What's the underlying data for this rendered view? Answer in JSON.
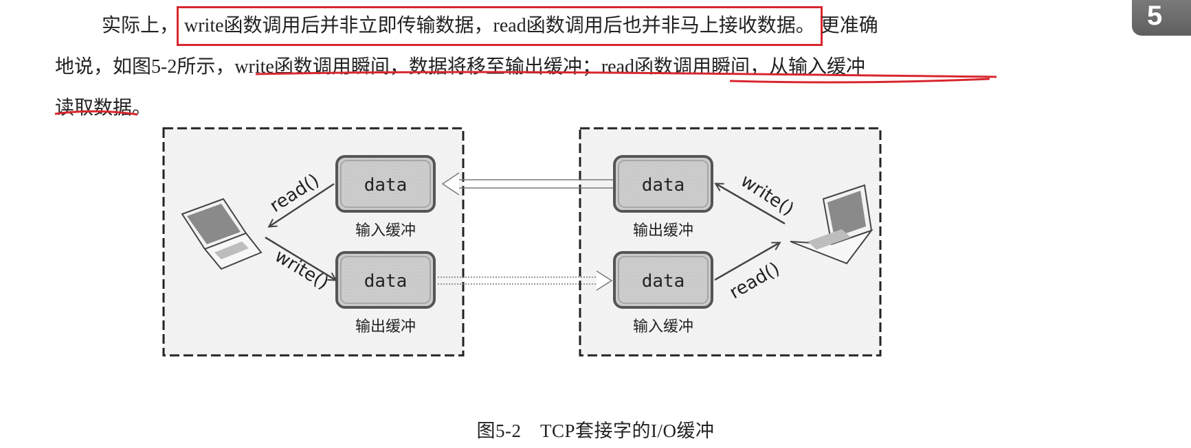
{
  "chapter_tab": "5",
  "paragraph": {
    "line1_start": "实际上，",
    "line1_boxed": "write函数调用后并非立即传输数据，read函数调用后也并非马上接收数据。",
    "line1_end": "更准确",
    "line2_start": "地说，如图5-2所示，",
    "line2_underlined": "write函数调用瞬间，数据将移至输出缓冲；read函数调用瞬间，从输入缓冲",
    "line3_underlined": "读取数据",
    "line3_end": "。"
  },
  "figure": {
    "left_host": {
      "top_buffer": {
        "label": "data",
        "caption": "输入缓冲",
        "arrow_label": "read()"
      },
      "bottom_buffer": {
        "label": "data",
        "caption": "输出缓冲",
        "arrow_label": "write()"
      }
    },
    "right_host": {
      "top_buffer": {
        "label": "data",
        "caption": "输出缓冲",
        "arrow_label": "write()"
      },
      "bottom_buffer": {
        "label": "data",
        "caption": "输入缓冲",
        "arrow_label": "read()"
      }
    },
    "caption": "图5-2　TCP套接字的I/O缓冲"
  },
  "colors": {
    "annotation_red": "#d8262e",
    "chapter_tab": "#6b6b6b"
  }
}
